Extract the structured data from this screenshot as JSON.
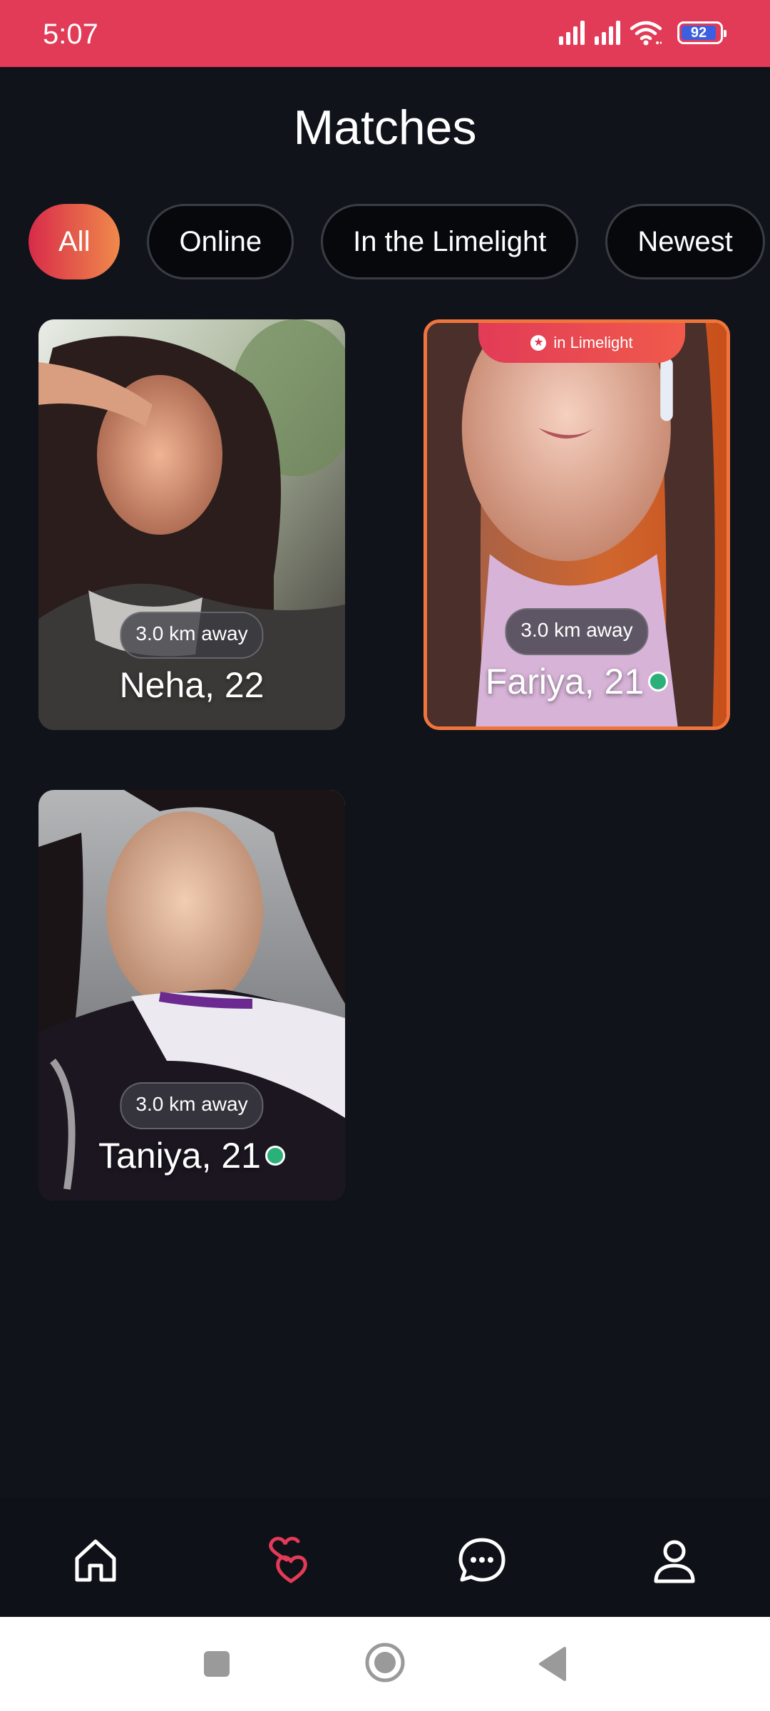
{
  "status_bar": {
    "time": "5:07",
    "battery": "92",
    "icons": [
      "signal-icon",
      "signal-icon",
      "wifi-icon",
      "battery-icon"
    ]
  },
  "header": {
    "title": "Matches"
  },
  "filters": {
    "chips": [
      {
        "label": "All",
        "active": true
      },
      {
        "label": "Online",
        "active": false
      },
      {
        "label": "In the Limelight",
        "active": false
      },
      {
        "label": "Newest",
        "active": false
      }
    ]
  },
  "matches": [
    {
      "name_age": "Neha, 22",
      "distance": "3.0 km away",
      "online": false,
      "limelight": false
    },
    {
      "name_age": "Fariya, 21",
      "distance": "3.0 km away",
      "online": true,
      "limelight": true,
      "badge": "in Limelight"
    },
    {
      "name_age": "Taniya, 21",
      "distance": "3.0 km away",
      "online": true,
      "limelight": false
    }
  ],
  "bottom_nav": {
    "items": [
      {
        "icon": "home-icon",
        "active": false
      },
      {
        "icon": "hearts-icon",
        "active": true
      },
      {
        "icon": "chat-icon",
        "active": false
      },
      {
        "icon": "profile-icon",
        "active": false
      }
    ],
    "active_color": "#e23b57"
  },
  "system_nav": {
    "items": [
      "recents-icon",
      "home-circle-icon",
      "back-icon"
    ]
  },
  "colors": {
    "accent": "#e23b57",
    "accent_gradient_end": "#f08a4b",
    "background": "#10131a",
    "online": "#2bb07a"
  }
}
